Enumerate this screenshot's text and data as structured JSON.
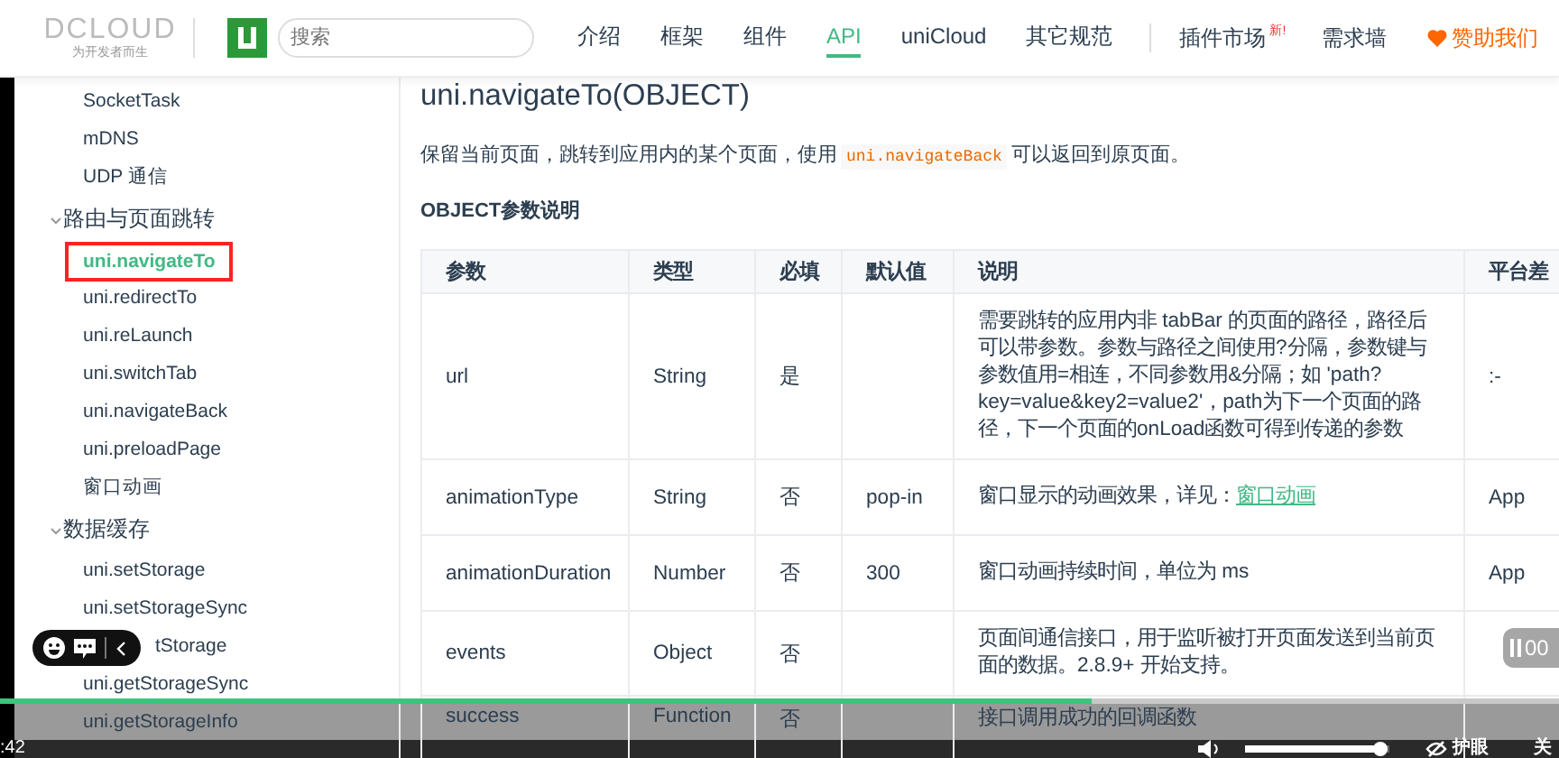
{
  "header": {
    "logo": "DCLOUD",
    "slogan": "为开发者而生",
    "search": {
      "placeholder": "搜索"
    },
    "nav": [
      {
        "label": "介绍",
        "selected": false
      },
      {
        "label": "框架",
        "selected": false
      },
      {
        "label": "组件",
        "selected": false
      },
      {
        "label": "API",
        "selected": true
      },
      {
        "label": "uniCloud",
        "selected": false
      },
      {
        "label": "其它规范",
        "selected": false
      }
    ],
    "extra_nav": [
      {
        "label": "插件市场",
        "badge": "新!"
      },
      {
        "label": "需求墙"
      }
    ],
    "sponsor": "赞助我们"
  },
  "sidebar": {
    "items": [
      {
        "label": "SocketTask",
        "selected": false
      },
      {
        "label": "mDNS",
        "selected": false
      },
      {
        "label": "UDP 通信",
        "selected": false
      }
    ],
    "sections": [
      {
        "label": "路由与页面跳转",
        "expanded": true,
        "children": [
          {
            "label": "uni.navigateTo",
            "selected": true
          },
          {
            "label": "uni.redirectTo",
            "selected": false
          },
          {
            "label": "uni.reLaunch",
            "selected": false
          },
          {
            "label": "uni.switchTab",
            "selected": false
          },
          {
            "label": "uni.navigateBack",
            "selected": false
          },
          {
            "label": "uni.preloadPage",
            "selected": false
          },
          {
            "label": "窗口动画",
            "selected": false
          }
        ]
      },
      {
        "label": "数据缓存",
        "expanded": true,
        "children": [
          {
            "label": "uni.setStorage",
            "selected": false
          },
          {
            "label": "uni.setStorageSync",
            "selected": false
          },
          {
            "label": "tStorage",
            "selected": false
          },
          {
            "label": "uni.getStorageSync",
            "selected": false
          },
          {
            "label": "uni.getStorageInfo",
            "selected": false
          }
        ]
      }
    ]
  },
  "content": {
    "title": "uni.navigateTo(OBJECT)",
    "intro": [
      "保留当前页面，跳转到应用内的某个页面，使用",
      "uni.navigateBack",
      "可以返回到原页面。"
    ],
    "table_title": "OBJECT参数说明",
    "table": {
      "columns": [
        "参数",
        "类型",
        "必填",
        "默认值",
        "说明",
        "平台差"
      ],
      "rows": [
        {
          "cells": [
            "url",
            "String",
            "是",
            "",
            "需要跳转的应用内非 tabBar 的页面的路径，路径后可以带参数。参数与路径之间使用?分隔，参数键与参数值用=相连，不同参数用&分隔；如 'path?key=value&key2=value2'，path为下一个页面的路径，下一个页面的onLoad函数可得到传递的参数",
            ":-"
          ]
        },
        {
          "cells": [
            "animationType",
            "String",
            "否",
            "pop-in",
            "窗口显示的动画效果，详见：",
            "App"
          ],
          "link": "窗口动画"
        },
        {
          "cells": [
            "animationDuration",
            "Number",
            "否",
            "300",
            "窗口动画持续时间，单位为 ms",
            "App"
          ]
        },
        {
          "cells": [
            "events",
            "Object",
            "否",
            "",
            "页面间通信接口，用于监听被打开页面发送到当前页面的数据。2.8.9+ 开始支持。",
            ""
          ]
        },
        {
          "cells": [
            "success",
            "Function",
            "否",
            "",
            "接口调用成功的回调函数",
            ""
          ]
        }
      ]
    }
  },
  "player": {
    "progress": {
      "level": 0.7
    },
    "time": ":42",
    "pause_badge": "00",
    "volume": {
      "level": 0.94
    },
    "eye_care": "护眼",
    "eye_care_state": "关"
  }
}
